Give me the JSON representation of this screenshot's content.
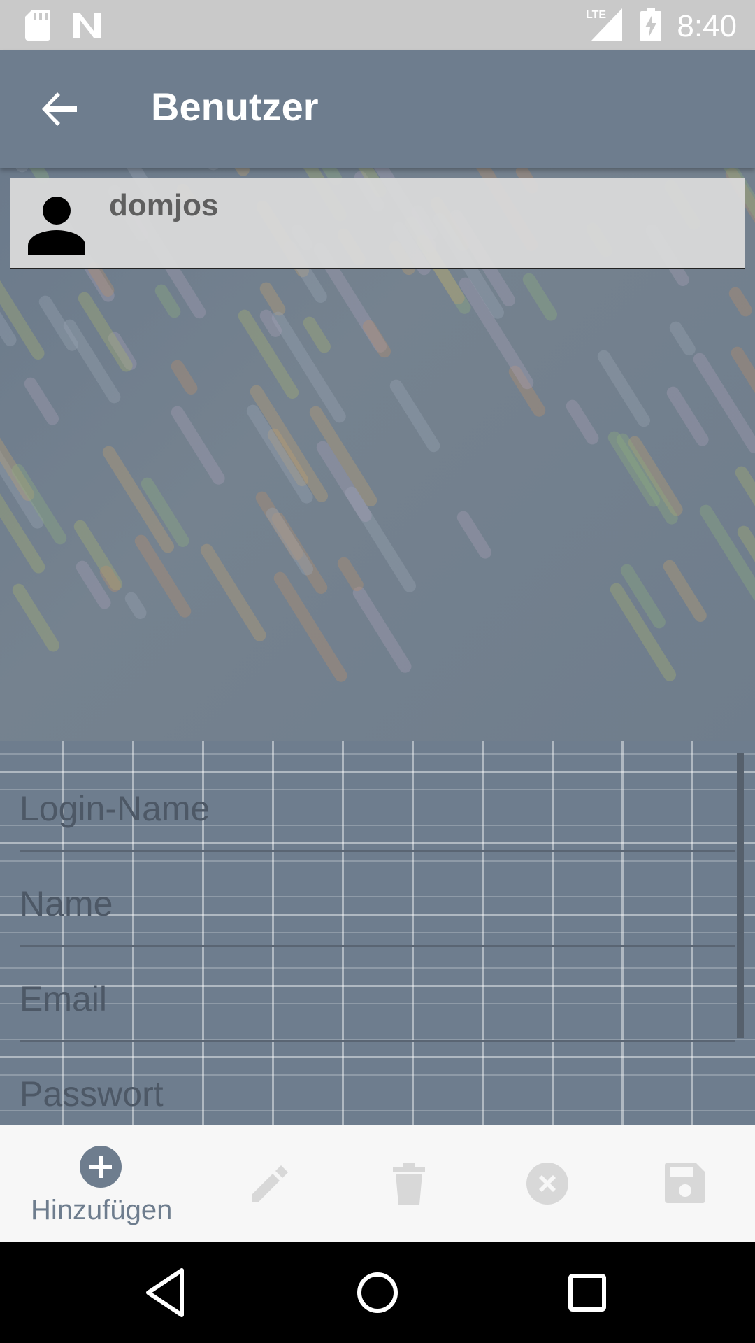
{
  "status_bar": {
    "time": "8:40",
    "network": "LTE",
    "icons": [
      "sd-card-icon",
      "n-logo-icon",
      "lte-signal-icon",
      "battery-charging-icon"
    ]
  },
  "app_bar": {
    "title": "Benutzer",
    "back_icon": "arrow-back-icon"
  },
  "users": [
    {
      "username": "domjos",
      "icon": "person-icon"
    }
  ],
  "form": {
    "fields": [
      {
        "placeholder": "Login-Name",
        "value": ""
      },
      {
        "placeholder": "Name",
        "value": ""
      },
      {
        "placeholder": "Email",
        "value": ""
      },
      {
        "placeholder": "Passwort",
        "value": ""
      }
    ]
  },
  "actions": {
    "add_label": "Hinzufügen",
    "items": [
      "add-circle-icon",
      "edit-icon",
      "delete-icon",
      "cancel-icon",
      "save-icon"
    ]
  },
  "colors": {
    "primary": "#6e7d8e",
    "status_bar": "#c9c9c9",
    "action_bar": "#f7f7f7",
    "disabled_icon": "#d8d8d8"
  }
}
